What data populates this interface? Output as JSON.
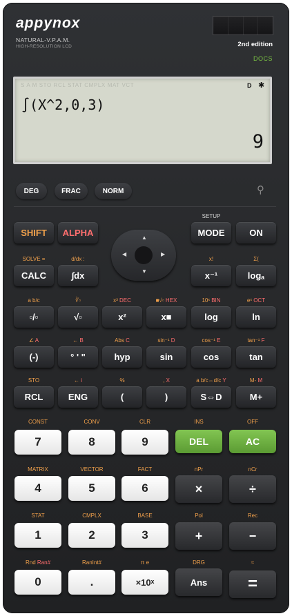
{
  "brand": {
    "name": "appynox",
    "line1": "NATURAL-V.P.A.M.",
    "line2": "HIGH-RESOLUTION LCD",
    "edition": "2nd edition",
    "docs": "DOCS"
  },
  "display": {
    "indicators": "S  A  M  STO  RCL  STAT  CMPLX  MAT  VCT",
    "angle_mode": "D",
    "settings_icon": "gear-icon",
    "expression": "∫(X^2,0,3)",
    "result": "9"
  },
  "mode_bar": {
    "deg": "DEG",
    "frac": "FRAC",
    "norm": "NORM",
    "zoom_icon": "magnifier-icon"
  },
  "colors": {
    "shift": "#f0a04b",
    "alpha": "#ff6e6e",
    "green": "#6aae3f",
    "body": "#2a2b2e",
    "lcd": "#d5d8cc"
  },
  "labels": {
    "setup": "SETUP",
    "solve": "SOLVE =",
    "ddx": "d/dx :",
    "fact_excl": "x!",
    "sigma": "Σ(",
    "abc": "a b/c",
    "root3": "∛▫",
    "x3": "x³",
    "dec": "DEC",
    "nroot": "■√▫",
    "hex": "HEX",
    "ten_x": "10ˣ",
    "bin": "BIN",
    "e_x": "eˣ",
    "oct": "OCT",
    "angle": "∠",
    "a": "A",
    "larrow": "←",
    "b": "B",
    "abs": "Abs",
    "c": "C",
    "asin": "sin⁻¹",
    "d": "D",
    "acos": "cos⁻¹",
    "e": "E",
    "atan": "tan⁻¹",
    "f": "F",
    "sto": "STO",
    "larrow2": "←",
    "i": "i",
    "percent": "%",
    "comma": ",",
    "x": "X",
    "abcdc": "a b/c⇔d/c",
    "y": "Y",
    "mminus": "M-",
    "m": "M",
    "const": "CONST",
    "conv": "CONV",
    "clr": "CLR",
    "ins": "INS",
    "off": "OFF",
    "matrix": "MATRIX",
    "vector": "VECTOR",
    "factl": "FACT",
    "npr": "nPr",
    "ncr": "nCr",
    "stat": "STAT",
    "cmplx": "CMPLX",
    "base": "BASE",
    "pol": "Pol",
    "rec": "Rec",
    "rnd": "Rnd",
    "ran": "Ran#",
    "ranint": "RanInt#",
    "pie": "π e",
    "drg": "DRG",
    "approx": "≈"
  },
  "keys": {
    "shift": "SHIFT",
    "alpha": "ALPHA",
    "mode": "MODE",
    "on": "ON",
    "calc": "CALC",
    "integral": "∫dx",
    "inverse": "x⁻¹",
    "log_a": "logₐ",
    "frac": "▫/▫",
    "sqrt": "√▫",
    "square": "x²",
    "power": "x■",
    "log": "log",
    "ln": "ln",
    "neg": "(-)",
    "dms": "° ' \"",
    "hyp": "hyp",
    "sin": "sin",
    "cos": "cos",
    "tan": "tan",
    "rcl": "RCL",
    "eng": "ENG",
    "lparen": "(",
    "rparen": ")",
    "sd": "S⇔D",
    "mplus": "M+",
    "d7": "7",
    "d8": "8",
    "d9": "9",
    "del": "DEL",
    "ac": "AC",
    "d4": "4",
    "d5": "5",
    "d6": "6",
    "mult": "×",
    "div": "÷",
    "d1": "1",
    "d2": "2",
    "d3": "3",
    "plus": "+",
    "minus": "−",
    "d0": "0",
    "dot": ".",
    "exp": "×10ˣ",
    "ans": "Ans",
    "equals": "="
  }
}
